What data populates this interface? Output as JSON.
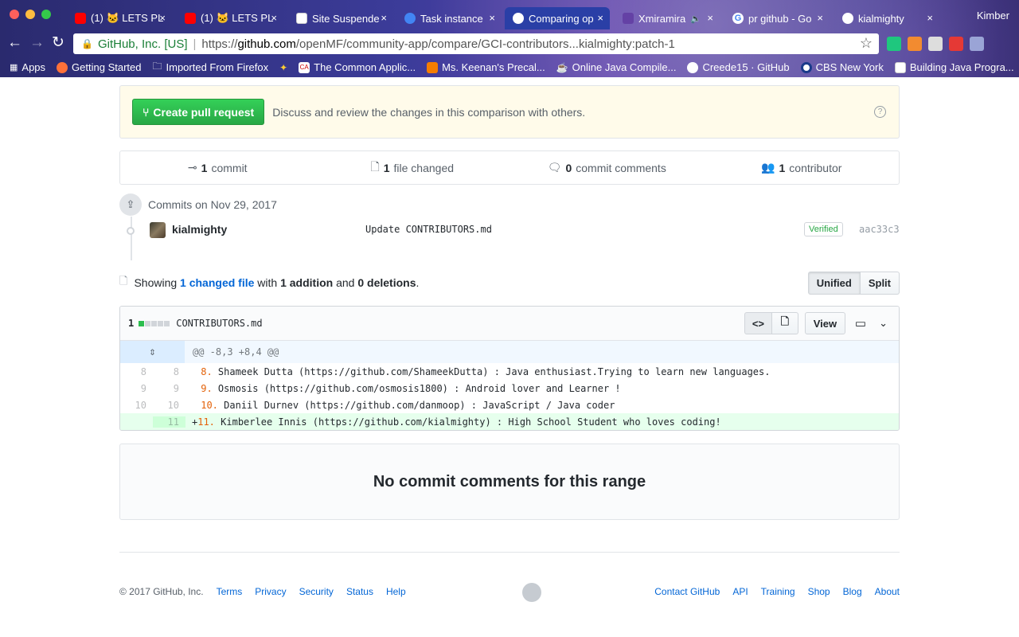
{
  "browser": {
    "profile": "Kimber",
    "tabs": [
      {
        "title": "(1) 🐱 LETS PL",
        "favicon": "youtube-icon",
        "color": "#ff0000"
      },
      {
        "title": "(1) 🐱 LETS PL",
        "favicon": "youtube-icon",
        "color": "#ff0000"
      },
      {
        "title": "Site Suspende",
        "favicon": "page-icon",
        "color": "#ffffff"
      },
      {
        "title": "Task instance",
        "favicon": "gci-icon",
        "color": "#4285f4"
      },
      {
        "title": "Comparing op",
        "favicon": "github-icon",
        "color": "#ffffff"
      },
      {
        "title": "Xmiramira",
        "favicon": "twitch-icon",
        "color": "#6441a5"
      },
      {
        "title": "pr github - Go",
        "favicon": "google-icon",
        "color": "#4285f4"
      },
      {
        "title": "kialmighty",
        "favicon": "github-icon",
        "color": "#ffffff"
      }
    ],
    "omnibox": {
      "secure_label": "GitHub, Inc. [US]",
      "url_prefix": "https://",
      "url_host": "github.com",
      "url_path": "/openMF/community-app/compare/GCI-contributors...kialmighty:patch-1"
    },
    "bookmarks": [
      {
        "label": "Apps",
        "icon": "apps-grid-icon"
      },
      {
        "label": "Getting Started",
        "icon": "firefox-icon"
      },
      {
        "label": "Imported From Firefox",
        "icon": "folder-icon"
      },
      {
        "label": "",
        "icon": "pinwheel-icon"
      },
      {
        "label": "The Common Applic...",
        "icon": "ca-icon"
      },
      {
        "label": "Ms. Keenan's Precal...",
        "icon": "blogger-icon"
      },
      {
        "label": "Online Java Compile...",
        "icon": "java-icon"
      },
      {
        "label": "Creede15 · GitHub",
        "icon": "github-icon"
      },
      {
        "label": "CBS New York",
        "icon": "cbs-icon"
      },
      {
        "label": "Building Java Progra...",
        "icon": "page-icon"
      }
    ]
  },
  "flash": {
    "button": "Create pull request",
    "text": "Discuss and review the changes in this comparison with others."
  },
  "summary": {
    "commits_n": "1",
    "commits_label": "commit",
    "files_n": "1",
    "files_label": "file changed",
    "comments_n": "0",
    "comments_label": "commit comments",
    "contributors_n": "1",
    "contributors_label": "contributor"
  },
  "commits": {
    "date_heading": "Commits on Nov 29, 2017",
    "items": [
      {
        "author": "kialmighty",
        "message": "Update CONTRIBUTORS.md",
        "badge": "Verified",
        "sha": "aac33c3"
      }
    ]
  },
  "showing": {
    "prefix": "Showing",
    "changed": "1 changed file",
    "with": "with",
    "additions": "1 addition",
    "and": "and",
    "deletions": "0 deletions",
    "period": ".",
    "unified": "Unified",
    "split": "Split"
  },
  "file": {
    "count": "1",
    "name": "CONTRIBUTORS.md",
    "view_label": "View",
    "hunk": "@@ -8,3 +8,4 @@",
    "lines": [
      {
        "old": "8",
        "new": "8",
        "prefix": " ",
        "num": "8.",
        "text": " Shameek Dutta (https://github.com/ShameekDutta) : Java enthusiast.Trying to learn new languages."
      },
      {
        "old": "9",
        "new": "9",
        "prefix": " ",
        "num": "9.",
        "text": " Osmosis (https://github.com/osmosis1800) : Android lover and Learner !"
      },
      {
        "old": "10",
        "new": "10",
        "prefix": " ",
        "num": "10.",
        "text": " Daniil Durnev (https://github.com/danmoop) : JavaScript / Java coder"
      },
      {
        "old": "",
        "new": "11",
        "prefix": "+",
        "num": "11.",
        "text": " Kimberlee Innis (https://github.com/kialmighty) : High School Student who loves coding!"
      }
    ]
  },
  "no_comments": "No commit comments for this range",
  "footer": {
    "copyright": "© 2017 GitHub, Inc.",
    "left_links": [
      "Terms",
      "Privacy",
      "Security",
      "Status",
      "Help"
    ],
    "right_links": [
      "Contact GitHub",
      "API",
      "Training",
      "Shop",
      "Blog",
      "About"
    ]
  }
}
